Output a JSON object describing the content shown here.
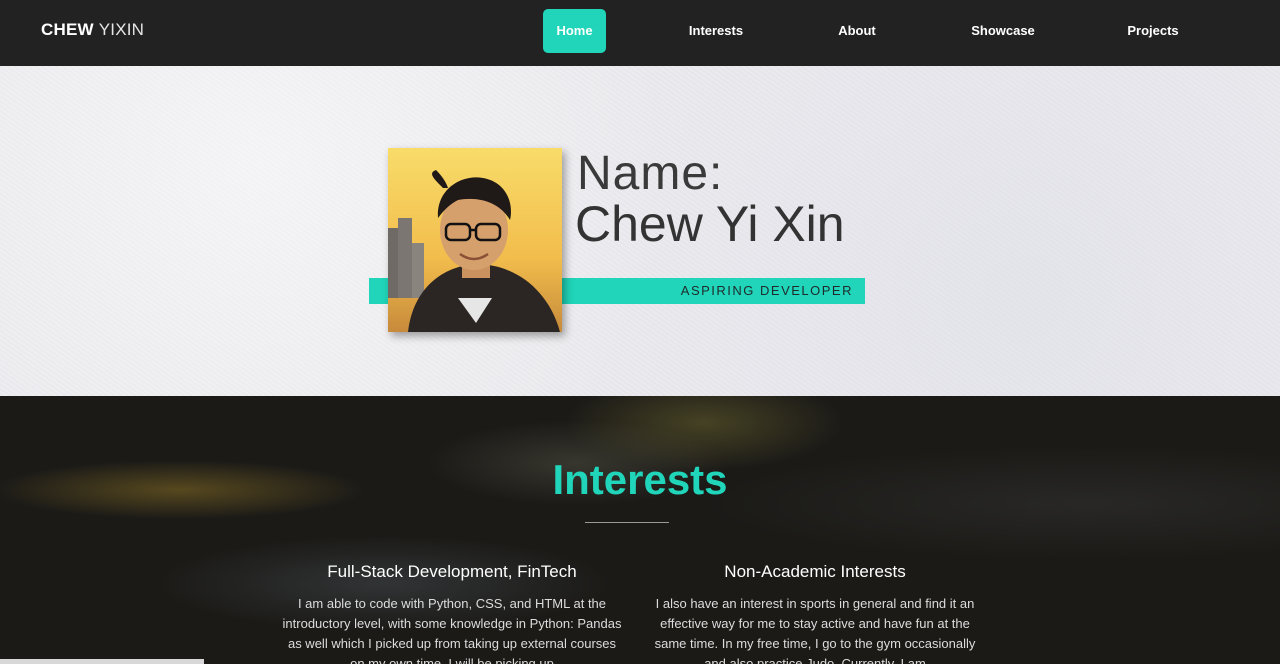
{
  "nav": {
    "brand_first": "CHEW",
    "brand_second": "YIXIN",
    "items": [
      {
        "label": "Home",
        "active": true
      },
      {
        "label": "Interests"
      },
      {
        "label": "About"
      },
      {
        "label": "Showcase"
      },
      {
        "label": "Projects"
      }
    ],
    "accent": "#20d5b9"
  },
  "hero": {
    "name_label": "Name:",
    "name_value": "Chew Yi Xin",
    "tagline": "ASPIRING DEVELOPER",
    "photo_icon": "profile-photo"
  },
  "interests": {
    "title": "Interests",
    "columns": [
      {
        "heading": "Full-Stack Development, FinTech",
        "text": "I am able to code with Python, CSS, and HTML at the introductory level, with some knowledge in Python: Pandas as well which I picked up from taking up external courses on my own time. I will be picking up"
      },
      {
        "heading": "Non-Academic Interests",
        "text": "I also have an interest in sports in general and find it an effective way for me to stay active and have fun at the same time. In my free time, I go to the gym occasionally and also practice Judo. Currently, I am"
      }
    ]
  }
}
